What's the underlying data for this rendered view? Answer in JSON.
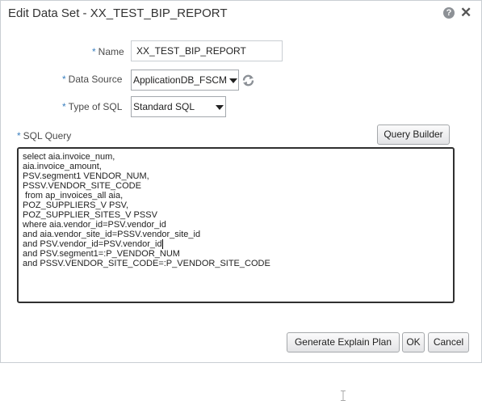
{
  "dialog": {
    "title": "Edit Data Set - XX_TEST_BIP_REPORT",
    "help_icon": "?",
    "close_icon": "✕"
  },
  "form": {
    "required_mark": "*",
    "name_label": "Name",
    "name_value": "XX_TEST_BIP_REPORT",
    "data_source_label": "Data Source",
    "data_source_value": "ApplicationDB_FSCM",
    "type_of_sql_label": "Type of SQL",
    "type_of_sql_value": "Standard SQL",
    "sql_query_label": "SQL Query",
    "query_builder_label": "Query Builder",
    "sql_lines": [
      "select aia.invoice_num,",
      "aia.invoice_amount,",
      "PSV.segment1 VENDOR_NUM,",
      "PSSV.VENDOR_SITE_CODE",
      " from ap_invoices_all aia,",
      "POZ_SUPPLIERS_V PSV,",
      "POZ_SUPPLIER_SITES_V PSSV",
      "where aia.vendor_id=PSV.vendor_id",
      "and aia.vendor_site_id=PSSV.vendor_site_id",
      "and PSV.vendor_id=PSV.vendor_id",
      "and PSV.segment1=:P_VENDOR_NUM",
      "and PSSV.VENDOR_SITE_CODE=:P_VENDOR_SITE_CODE"
    ]
  },
  "footer": {
    "explain_plan_label": "Generate Explain Plan",
    "ok_label": "OK",
    "cancel_label": "Cancel"
  },
  "icons": {
    "help": "help-icon",
    "close": "close-icon",
    "refresh": "refresh-icon",
    "dropdown": "chevron-down-icon"
  },
  "colors": {
    "required_mark": "#3a7fbf",
    "help_icon_bg": "#8d9196",
    "sql_box_border": "#303030"
  }
}
